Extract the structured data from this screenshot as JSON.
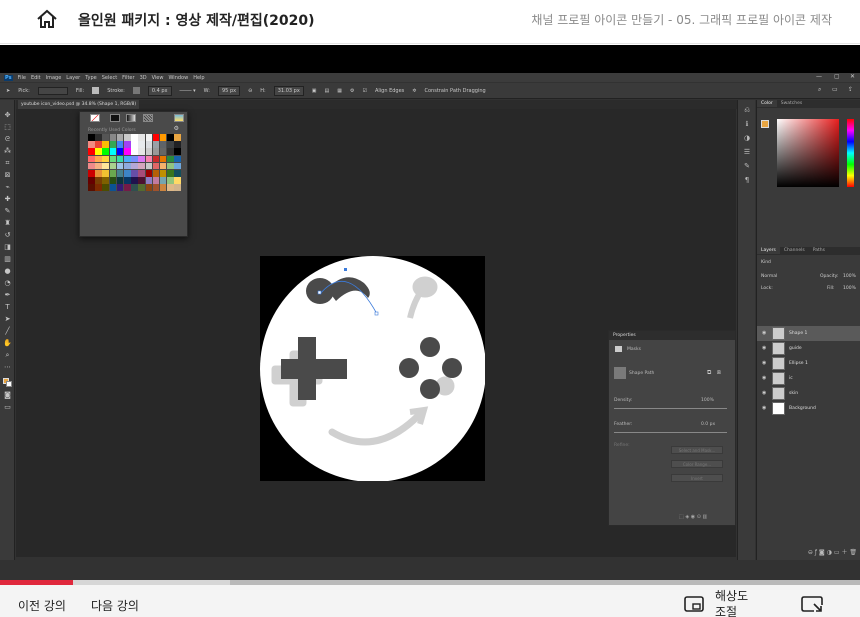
{
  "header": {
    "course_title": "올인원 패키지 : 영상 제작/편집(2020)",
    "lesson_title": "채널 프로필 아이콘 만들기 - 05. 그래픽 프로필 아이콘 제작"
  },
  "photoshop": {
    "menu": [
      "File",
      "Edit",
      "Image",
      "Layer",
      "Type",
      "Select",
      "Filter",
      "3D",
      "View",
      "Window",
      "Help"
    ],
    "options_bar": {
      "pick": "Pick:",
      "fill_label": "Fill:",
      "stroke_label": "Stroke:",
      "stroke_width": "0.4 px",
      "w_label": "W:",
      "w_value": "95 px",
      "h_label": "H:",
      "h_value": "31.03 px",
      "align_edges": "Align Edges",
      "constrain_path": "Constrain Path Dragging"
    },
    "doc_tab": "youtube icon_video.psd @ 34.8% (Shape 1, RGB/8)",
    "swatches": {
      "label": "Recently Used Colors",
      "colors": [
        "#000000",
        "#2b2b2b",
        "#555555",
        "#888888",
        "#aaaaaa",
        "#cccccc",
        "#ffffff",
        "#e6e6e6",
        "#f2f2f2",
        "#ff0000",
        "#ff9900",
        "#000000",
        "#e9a642",
        "#f28b82",
        "#ea4335",
        "#fbbc05",
        "#34a853",
        "#4285f4",
        "#a142f4",
        "#ffffff",
        "#e8eaed",
        "#dadce0",
        "#9aa0a6",
        "#5f6368",
        "#3c4043",
        "#202124",
        "#ff0000",
        "#ffff00",
        "#00ff00",
        "#00ffff",
        "#0000ff",
        "#ff00ff",
        "#ffffff",
        "#e6e6e6",
        "#cccccc",
        "#999999",
        "#666666",
        "#333333",
        "#000000",
        "#ff6b6b",
        "#ffa94d",
        "#ffd43b",
        "#69db7c",
        "#38d9a9",
        "#4dabf7",
        "#748ffc",
        "#da77f2",
        "#f783ac",
        "#c92a2a",
        "#e67700",
        "#2b8a3e",
        "#1864ab",
        "#ee8a8a",
        "#f4b183",
        "#ffe699",
        "#a9d18e",
        "#9dc3e6",
        "#8faadc",
        "#b4a7d6",
        "#d5a6bd",
        "#c9c9c9",
        "#e06666",
        "#f6b26b",
        "#93c47d",
        "#6fa8dc",
        "#cc0000",
        "#e69138",
        "#f1c232",
        "#6aa84f",
        "#45818e",
        "#3d85c6",
        "#674ea7",
        "#a64d79",
        "#990000",
        "#b45f06",
        "#bf9000",
        "#38761d",
        "#134f5c",
        "#660000",
        "#783f04",
        "#7f6000",
        "#274e13",
        "#0c343d",
        "#073763",
        "#20124d",
        "#4c1130",
        "#8e7cc3",
        "#c27ba0",
        "#76a5af",
        "#93c47d",
        "#ffd966",
        "#5b0f00",
        "#7f2a00",
        "#4d4d00",
        "#0b5394",
        "#351c75",
        "#741b47",
        "#2f4f4f",
        "#556b2f",
        "#8b4513",
        "#a0522d",
        "#cd853f",
        "#deb887",
        "#d2b48c"
      ]
    },
    "panels": {
      "color_tabs": [
        "Color",
        "Swatches"
      ],
      "layer_tabs": [
        "Layers",
        "Channels",
        "Paths"
      ],
      "kind": "Kind",
      "blend_mode": "Normal",
      "opacity_label": "Opacity:",
      "opacity": "100%",
      "lock_label": "Lock:",
      "fill_label": "Fill:",
      "fill": "100%",
      "layers": [
        {
          "name": "Shape 1",
          "selected": true
        },
        {
          "name": "guide",
          "selected": false
        },
        {
          "name": "Ellipse 1",
          "selected": false
        },
        {
          "name": "ic",
          "selected": false
        },
        {
          "name": "skin",
          "selected": false
        },
        {
          "name": "Background",
          "selected": false
        }
      ]
    },
    "properties": {
      "title": "Properties",
      "masks": "Masks",
      "shape_path": "Shape Path",
      "density_label": "Density:",
      "density": "100%",
      "feather_label": "Feather:",
      "feather": "0.0 px",
      "refine_label": "Refine:",
      "btn_select_mask": "Select and Mask...",
      "btn_color_range": "Color Range...",
      "btn_invert": "Invert"
    },
    "status": {
      "zoom": "34.8%",
      "doc": "Doc: 732.4K/4.43M"
    }
  },
  "player": {
    "progress": 0.085,
    "prev": "이전 강의",
    "next": "다음 강의",
    "resolution": "해상도 조절"
  }
}
